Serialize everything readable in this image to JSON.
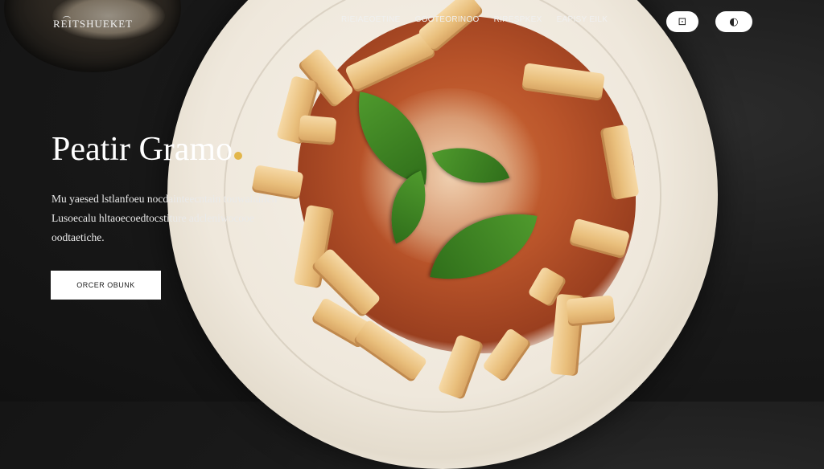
{
  "brand": {
    "name": "REITSHUEKET"
  },
  "nav": {
    "items": [
      {
        "label": "RIEIAEOETINE"
      },
      {
        "label": "GOOTEORINOO"
      },
      {
        "label": "RIRESPKEX"
      },
      {
        "label": "EAPISY EILK"
      }
    ]
  },
  "header_actions": {
    "cart_icon": "bag-icon",
    "user_icon": "user-icon",
    "cart_glyph": "⊡",
    "user_glyph": "◐"
  },
  "hero": {
    "headline": "Peatir Gramo",
    "description": "Mu yaesed lstlanfoeu nocdainteecntain touwahuilen Lusoecalu hltaoecoedtocstiture adcleniwocooe oodtaetiche.",
    "cta_label": "ORCER OBUNK"
  },
  "colors": {
    "background": "#1a1a1a",
    "plate": "#f2ece2",
    "sauce": "#b9542a",
    "basil": "#3f8524",
    "accent": "#e2b64a"
  }
}
